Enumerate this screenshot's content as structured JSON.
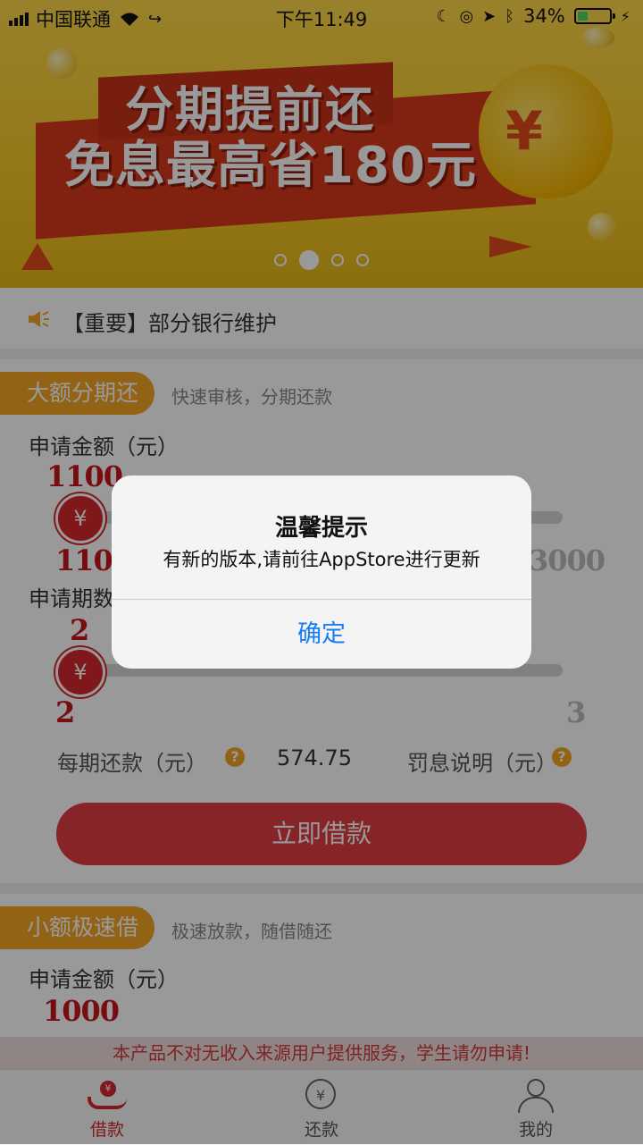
{
  "status": {
    "carrier": "中国联通",
    "time": "下午11:49",
    "battery": "34%"
  },
  "banner": {
    "line1": "分期提前还",
    "line2": "免息最高省180元",
    "page_index": 2,
    "page_count": 4
  },
  "notice": {
    "text": "【重要】部分银行维护"
  },
  "loan_large": {
    "title": "大额分期还",
    "subtitle": "快速审核，分期还款",
    "amount_label": "申请金额（元）",
    "amount_value": "1100",
    "amount_min": "1100",
    "amount_max": "3000",
    "period_label": "申请期数",
    "period_value": "2",
    "period_min": "2",
    "period_max": "3",
    "per_period_label": "每期还款（元）",
    "per_period_value": "574.75",
    "penalty_label": "罚息说明（元）",
    "cta": "立即借款"
  },
  "loan_small": {
    "title": "小额极速借",
    "subtitle": "极速放款，随借随还",
    "amount_label": "申请金额（元）",
    "amount_value": "1000"
  },
  "disclaimer": "本产品不对无收入来源用户提供服务，学生请勿申请!",
  "tabs": [
    {
      "label": "借款",
      "icon": "borrow-icon"
    },
    {
      "label": "还款",
      "icon": "repay-icon"
    },
    {
      "label": "我的",
      "icon": "profile-icon"
    }
  ],
  "alert": {
    "title": "温馨提示",
    "message": "有新的版本,请前往AppStore进行更新",
    "button": "确定"
  },
  "colors": {
    "accent_red": "#e23c44",
    "orange": "#f5a623",
    "ios_blue": "#1a7cf0",
    "battery_green": "#4cd964"
  }
}
